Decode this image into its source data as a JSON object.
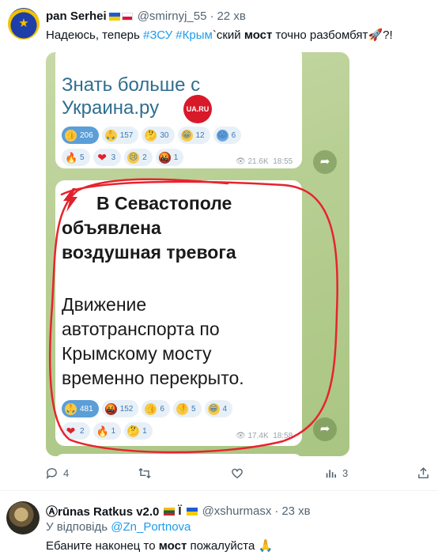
{
  "tweet1": {
    "name": "pan Serhei",
    "handle": "@smirnyj_55",
    "dot": "·",
    "time": "22 хв",
    "text_a": "Надеюсь, теперь ",
    "tag1": "#ЗСУ",
    "tag2": "#Крым",
    "text_b": "`ский ",
    "bold": "мост",
    "text_c": " точно разбомбят",
    "text_end": "?!",
    "actions": {
      "reply_count": "4",
      "retweet_count": "",
      "like_count": "",
      "views_count": "3"
    }
  },
  "card": {
    "post1_line1": "Знать больше с",
    "post1_line2": "Украина.ру",
    "logo_text": "UA.RU",
    "post1_reactions_row1": [
      {
        "emoji": "👍",
        "count": "206",
        "selected": true
      },
      {
        "emoji": "🙏",
        "count": "157",
        "selected": false
      },
      {
        "emoji": "🤔",
        "count": "30",
        "selected": false
      },
      {
        "emoji": "😁",
        "count": "12",
        "selected": false
      },
      {
        "emoji": "😱",
        "count": "6",
        "selected": false
      }
    ],
    "post1_reactions_row2": [
      {
        "emoji": "🔥",
        "count": "5"
      },
      {
        "emoji": "❤",
        "count": "3"
      },
      {
        "emoji": "😢",
        "count": "2"
      },
      {
        "emoji": "🤬",
        "count": "1"
      }
    ],
    "post1_views": "21.6K",
    "post1_time": "18:55",
    "post2_alert1": "В Севастополе",
    "post2_alert2": "объявлена",
    "post2_alert3": "воздушная тревога",
    "post2_msg1": "Движение",
    "post2_msg2": "автотранспорта по",
    "post2_msg3": "Крымскому мосту",
    "post2_msg4": "временно перекрыто.",
    "post2_reactions_row1": [
      {
        "emoji": "🙏",
        "count": "481",
        "selected": true
      },
      {
        "emoji": "🤬",
        "count": "152",
        "selected": false
      },
      {
        "emoji": "👍",
        "count": "6",
        "selected": false
      },
      {
        "emoji": "👎",
        "count": "5",
        "selected": false
      },
      {
        "emoji": "😁",
        "count": "4",
        "selected": false
      }
    ],
    "post2_reactions_row2": [
      {
        "emoji": "❤",
        "count": "2"
      },
      {
        "emoji": "🔥",
        "count": "1"
      },
      {
        "emoji": "🤔",
        "count": "1"
      }
    ],
    "post2_views": "17.4K",
    "post2_time": "18:58",
    "highlight_color": "#e8232d"
  },
  "tweet2": {
    "name": "Ⓐrūnas Ratkus v2.0",
    "mark": "Ï",
    "handle": "@xshurmasx",
    "dot": "·",
    "time": "23 хв",
    "reply_prefix": "У відповідь ",
    "reply_to": "@Zn_Portnova",
    "text_a": "Ебаните наконец то ",
    "bold": "мост",
    "text_b": " пожалуйста ",
    "emoji": "🙏"
  },
  "colors": {
    "link": "#1d9bf0",
    "muted": "#536471"
  }
}
